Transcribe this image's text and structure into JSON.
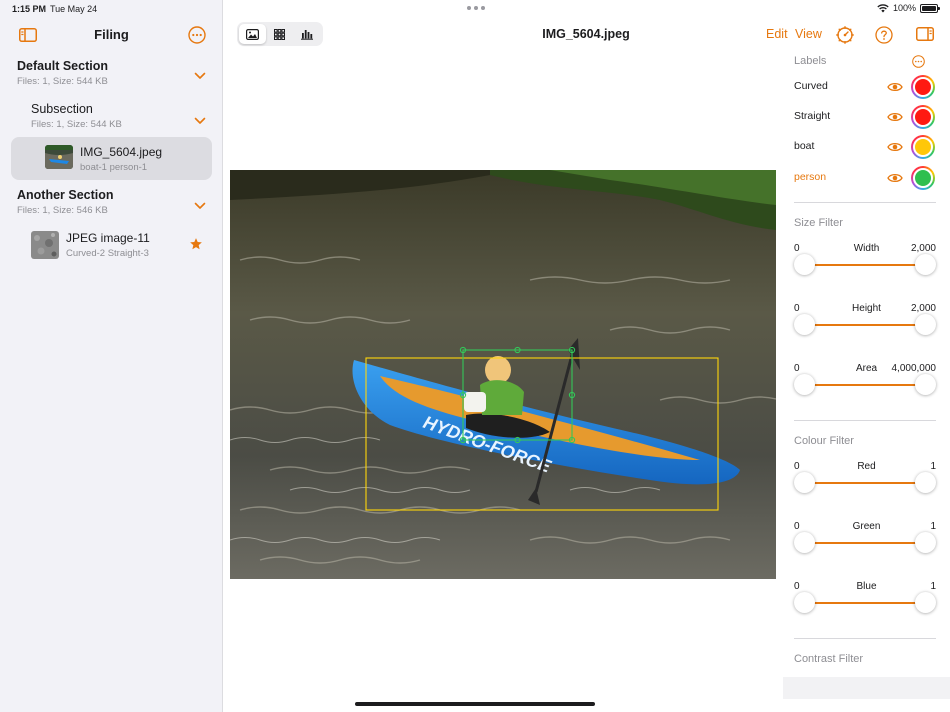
{
  "status": {
    "time": "1:15 PM",
    "date": "Tue May 24",
    "battery": "100%"
  },
  "sidebar": {
    "title": "Filing",
    "sections": [
      {
        "title": "Default Section",
        "meta": "Files: 1, Size: 544 KB"
      },
      {
        "title": "Subsection",
        "meta": "Files: 1, Size: 544 KB"
      },
      {
        "title": "Another Section",
        "meta": "Files: 1, Size: 546 KB"
      }
    ],
    "files": [
      {
        "name": "IMG_5604.jpeg",
        "labels": "boat-1 person-1",
        "selected": true
      },
      {
        "name": "JPEG image-11",
        "labels": "Curved-2 Straight-3",
        "starred": true
      }
    ]
  },
  "toolbar": {
    "title": "IMG_5604.jpeg",
    "edit_label": "Edit",
    "view_label": "View",
    "segments": [
      "image-view-icon",
      "grid-view-icon",
      "chart-view-icon"
    ],
    "active_segment": 0
  },
  "panel": {
    "labels_heading": "Labels",
    "labels": [
      {
        "name": "Curved",
        "color": "#ff1a12",
        "active": false
      },
      {
        "name": "Straight",
        "color": "#ff1a12",
        "active": false
      },
      {
        "name": "boat",
        "color": "#ffc709",
        "active": false
      },
      {
        "name": "person",
        "color": "#2fbf4f",
        "active": true
      }
    ],
    "size_filter": {
      "heading": "Size Filter",
      "sliders": [
        {
          "name": "Width",
          "min": "0",
          "max": "2,000"
        },
        {
          "name": "Height",
          "min": "0",
          "max": "2,000"
        },
        {
          "name": "Area",
          "min": "0",
          "max": "4,000,000"
        }
      ]
    },
    "colour_filter": {
      "heading": "Colour Filter",
      "sliders": [
        {
          "name": "Red",
          "min": "0",
          "max": "1"
        },
        {
          "name": "Green",
          "min": "0",
          "max": "1"
        },
        {
          "name": "Blue",
          "min": "0",
          "max": "1"
        }
      ]
    },
    "contrast_heading": "Contrast Filter"
  },
  "colors": {
    "accent": "#e6780f",
    "boat_box": "#ffd60a",
    "person_box": "#34c759"
  }
}
